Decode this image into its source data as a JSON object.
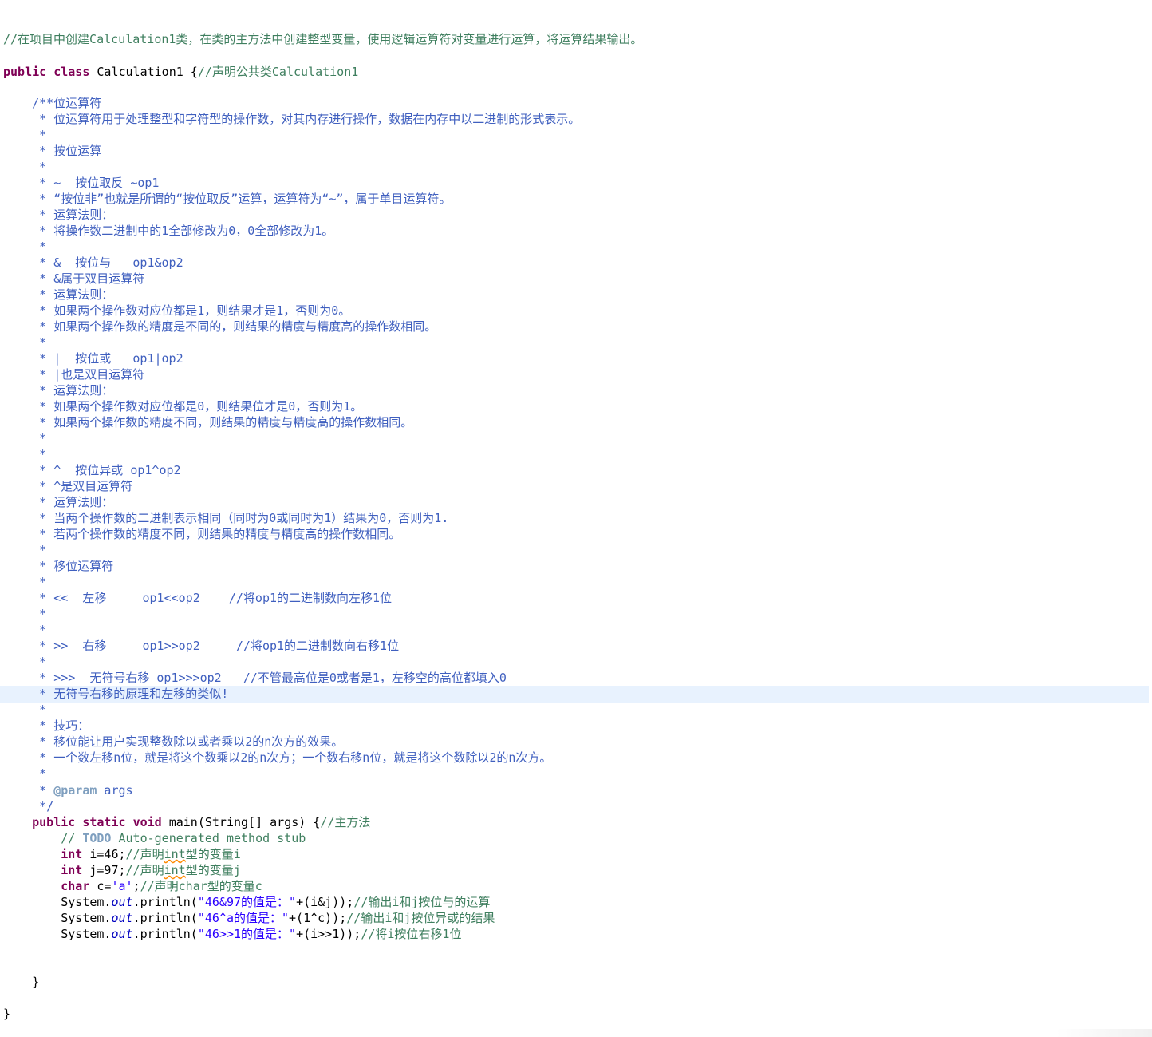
{
  "editor": {
    "lines": {
      "l1": "//在项目中创建Calculation1类，在类的主方法中创建整型变量，使用逻辑运算符对变量进行运算，将运算结果输出。",
      "l2_kw1": "public",
      "l2_kw2": "class",
      "l2_name": " Calculation1 {",
      "l2_cm": "//声明公共类Calculation1",
      "j01": "    /**位运算符",
      "j02": "     * 位运算符用于处理整型和字符型的操作数，对其内存进行操作，数据在内存中以二进制的形式表示。",
      "j03": "     *",
      "j04": "     * 按位运算",
      "j05": "     *",
      "j06": "     * ~  按位取反 ~op1",
      "j07": "     * “按位非”也就是所谓的“按位取反”运算，运算符为“~”，属于单目运算符。",
      "j08": "     * 运算法则：",
      "j09": "     * 将操作数二进制中的1全部修改为0，0全部修改为1。",
      "j10": "     *",
      "j11": "     * &  按位与   op1&op2",
      "j12": "     * &属于双目运算符",
      "j13": "     * 运算法则：",
      "j14": "     * 如果两个操作数对应位都是1，则结果才是1，否则为0。",
      "j15": "     * 如果两个操作数的精度是不同的，则结果的精度与精度高的操作数相同。",
      "j16": "     *",
      "j17": "     * |  按位或   op1|op2",
      "j18": "     * |也是双目运算符",
      "j19": "     * 运算法则：",
      "j20": "     * 如果两个操作数对应位都是0，则结果位才是0，否则为1。",
      "j21": "     * 如果两个操作数的精度不同，则结果的精度与精度高的操作数相同。",
      "j22": "     *",
      "j23": "     *",
      "j24": "     * ^  按位异或 op1^op2",
      "j25": "     * ^是双目运算符",
      "j26": "     * 运算法则：",
      "j27": "     * 当两个操作数的二进制表示相同（同时为0或同时为1）结果为0，否则为1.",
      "j28": "     * 若两个操作数的精度不同，则结果的精度与精度高的操作数相同。",
      "j29": "     *",
      "j30": "     * 移位运算符",
      "j31": "     *",
      "j32": "     * <<  左移     op1<<op2    //将op1的二进制数向左移1位",
      "j33": "     *",
      "j34": "     *",
      "j35": "     * >>  右移     op1>>op2     //将op1的二进制数向右移1位",
      "j36": "     *",
      "j37": "     * >>>  无符号右移 op1>>>op2   //不管最高位是0或者是1，左移空的高位都填入0",
      "j38": "     * 无符号右移的原理和左移的类似!",
      "j39": "     *",
      "j40": "     * 技巧：",
      "j41": "     * 移位能让用户实现整数除以或者乘以2的n次方的效果。",
      "j42": "     * 一个数左移n位，就是将这个数乘以2的n次方；一个数右移n位，就是将这个数除以2的n次方。",
      "j43": "     *",
      "j44_pre": "     * ",
      "j44_tag": "@param",
      "j44_post": " args",
      "j45": "     */",
      "m_indent": "    ",
      "m_kw1": "public",
      "m_kw2": "static",
      "m_kw3": "void",
      "m_sig": " main(String[] args) {",
      "m_cm": "//主方法",
      "todo_pre": "        // ",
      "todo_tag": "TODO",
      "todo_post": " Auto-generated method stub",
      "i_indent": "        ",
      "i_kw": "int",
      "i_code": " i=46;",
      "i_cm1": "//声明",
      "i_cm2": "int",
      "i_cm3": "型的变量i",
      "jv_kw": "int",
      "jv_code": " j=97;",
      "jv_cm1": "//声明",
      "jv_cm2": "int",
      "jv_cm3": "型的变量j",
      "c_kw": "char",
      "c_code1": " c=",
      "c_str": "'a'",
      "c_code2": ";",
      "c_cm": "//声明char型的变量c",
      "p_sys": "System.",
      "p_out": "out",
      "p_println": ".println(",
      "p1_str": "\"46&97的值是：\"",
      "p1_code": "+(i&j));",
      "p1_cm": "//输出i和j按位与的运算",
      "p2_str": "\"46^a的值是：\"",
      "p2_code": "+(1^c));",
      "p2_cm": "//输出i和j按位异或的结果",
      "p3_str": "\"46>>1的值是：\"",
      "p3_code": "+(i>>1));",
      "p3_cm": "//将i按位右移1位",
      "close_method": "    }",
      "close_class": "}"
    }
  }
}
